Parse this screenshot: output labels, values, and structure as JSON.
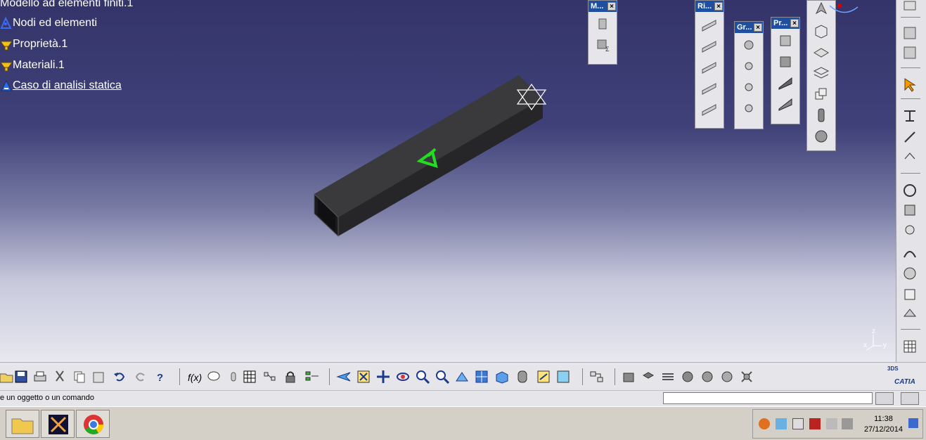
{
  "tree": {
    "root": "Modello ad elementi finiti.1",
    "items": [
      {
        "label": "Nodi ed elementi"
      },
      {
        "label": "Proprietà.1"
      },
      {
        "label": "Materiali.1"
      },
      {
        "label": "Caso di analisi statica"
      }
    ]
  },
  "floating_toolbars": [
    {
      "title": "M..."
    },
    {
      "title": "Ri..."
    },
    {
      "title": "Gr..."
    },
    {
      "title": "Pr..."
    }
  ],
  "compass": {
    "z": "z",
    "x": "x",
    "y": "y"
  },
  "status": {
    "message": "e un oggetto o un comando",
    "command_value": ""
  },
  "taskbar": {
    "time": "11:38",
    "date": "27/12/2014"
  },
  "brand": {
    "logo": "CATIA",
    "logo_sup": "3DS"
  },
  "colors": {
    "viewport_top": "#34346a",
    "beam": "#2f2f31",
    "accent_green": "#22dd22",
    "toolbar_header": "#1e4fa0"
  }
}
